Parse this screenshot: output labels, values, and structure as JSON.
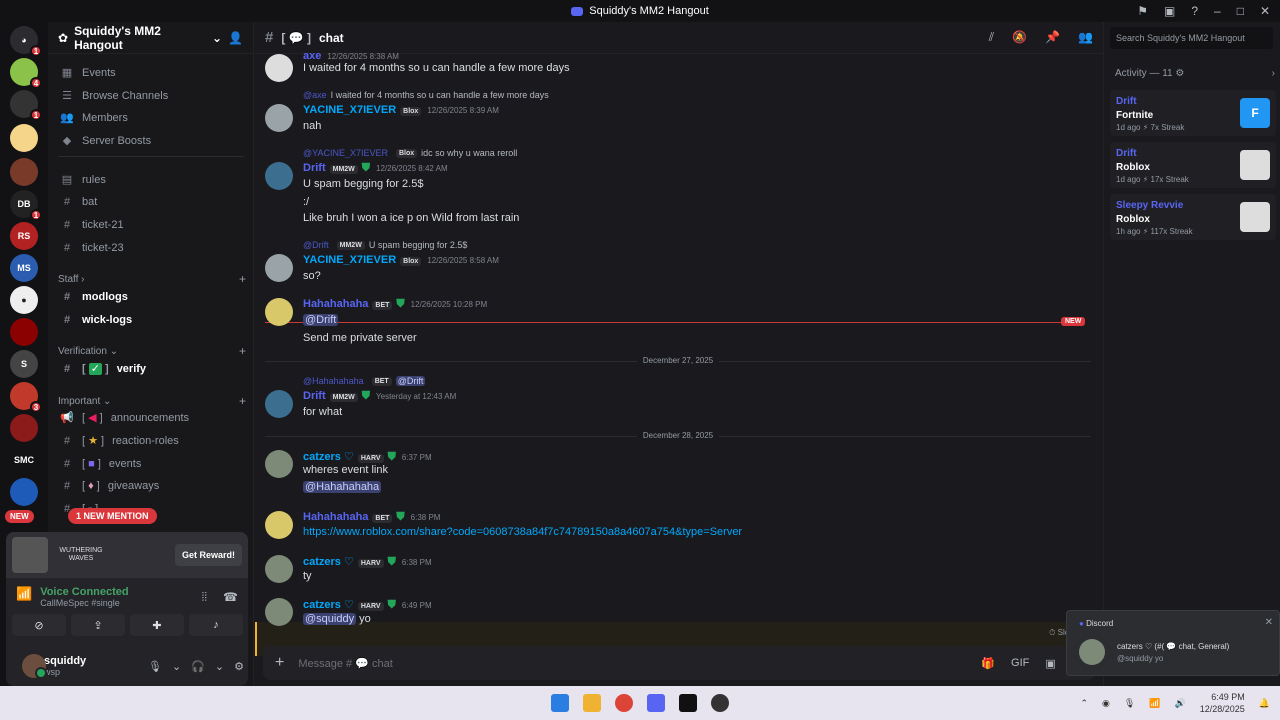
{
  "window": {
    "title": "Squiddy's MM2 Hangout"
  },
  "server": {
    "name": "Squiddy's MM2 Hangout"
  },
  "sidebar": {
    "items": [
      {
        "label": "Events",
        "icon": "calendar-icon"
      },
      {
        "label": "Browse Channels",
        "icon": "browse-icon"
      },
      {
        "label": "Members",
        "icon": "members-icon"
      },
      {
        "label": "Server Boosts",
        "icon": "boost-icon"
      }
    ],
    "channels_top": [
      "rules",
      "bat",
      "ticket-21",
      "ticket-23"
    ],
    "cat_staff": "Staff",
    "staff_channels": [
      "modlogs",
      "wick-logs"
    ],
    "cat_verification": "Verification",
    "verify": "verify",
    "cat_important": "Important",
    "important_channels": [
      "announcements",
      "reaction-roles",
      "events",
      "giveaways"
    ],
    "new_mention": "1 NEW MENTION",
    "new_pill": "NEW"
  },
  "promo": {
    "logo": "WUTHERING WAVES",
    "button": "Get Reward!"
  },
  "voice": {
    "status": "Voice Connected",
    "channel": "CallMeSpec #single"
  },
  "user": {
    "name": "squiddy",
    "status": "wsp"
  },
  "channel": {
    "name": "chat",
    "placeholder": "Message # 💬 chat",
    "slowmode": "Slowmode"
  },
  "messages": [
    {
      "name": "axe",
      "time": "12/26/2025 8:38 AM",
      "text": "I waited for 4 months so u can handle a few more days"
    },
    {
      "reply_name": "@axe",
      "reply_text": "I waited for 4 months so u can handle a few more days",
      "name": "YACINE_X7IEVER",
      "tag": "Blox",
      "time": "12/26/2025 8:39 AM",
      "text": "nah"
    },
    {
      "reply_name": "@YACINE_X7IEVER",
      "reply_tag": "Blox",
      "reply_text": "idc so why u wana reroll",
      "name": "Drift",
      "tag": "MM2W",
      "time": "12/26/2025 8:42 AM",
      "lines": [
        "U spam begging for 2.5$",
        ":/",
        "Like bruh I won a ice p on Wild from last rain"
      ]
    },
    {
      "reply_name": "@Drift",
      "reply_tag": "MM2W",
      "reply_text": "U spam begging for 2.5$",
      "name": "YACINE_X7IEVER",
      "tag": "Blox",
      "time": "12/26/2025 8:58 AM",
      "text": "so?"
    },
    {
      "name": "Hahahahaha",
      "tag": "BET",
      "time": "12/26/2025 10:28 PM",
      "mention": "@Drift",
      "text": "Send me private server"
    },
    {
      "reply_name": "@Hahahahaha",
      "reply_tag": "BET",
      "reply_text": "@Drift",
      "name": "Drift",
      "tag": "MM2W",
      "time": "Yesterday at 12:43 AM",
      "text": "for what"
    },
    {
      "name": "catzers ♡",
      "tag": "HARV",
      "time": "6:37 PM",
      "text": "wheres event link",
      "mention": "@Hahahahaha"
    },
    {
      "name": "Hahahahaha",
      "tag": "BET",
      "time": "6:38 PM",
      "link": "https://www.roblox.com/share?code=0608738a84f7c74789150a8a4607a754&type=Server"
    },
    {
      "name": "catzers ♡",
      "tag": "HARV",
      "time": "6:38 PM",
      "text": "ty"
    },
    {
      "name": "catzers ♡",
      "tag": "HARV",
      "time": "6:49 PM",
      "mention": "@squiddy",
      "text": "yo"
    }
  ],
  "dividers": [
    "December 27, 2025",
    "December 28, 2025"
  ],
  "new_label": "NEW",
  "search": {
    "placeholder": "Search Squiddy's MM2 Hangout"
  },
  "activity": {
    "header": "Activity — 11",
    "cards": [
      {
        "name": "Drift",
        "game": "Fortnite",
        "meta": "1d ago   ⚡ 7x Streak"
      },
      {
        "name": "Drift",
        "game": "Roblox",
        "meta": "1d ago   ⚡ 17x Streak"
      },
      {
        "name": "Sleepy Revvie",
        "game": "Roblox",
        "meta": "1h ago   ⚡ 117x Streak"
      }
    ]
  },
  "notification": {
    "app": "Discord",
    "line1": "catzers ♡ (#( 💬 chat, General)",
    "line2": "@squiddy  yo"
  },
  "taskbar": {
    "time": "6:49 PM",
    "date": "12/28/2025"
  }
}
